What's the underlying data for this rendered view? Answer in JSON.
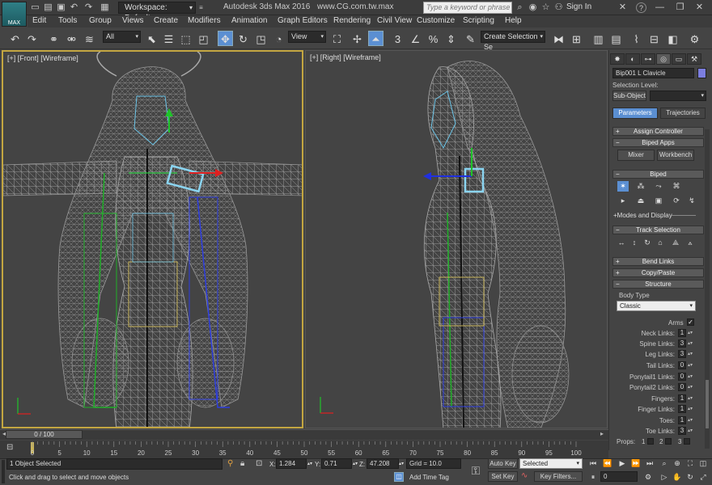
{
  "app": {
    "logo_text": "MAX",
    "workspace_label": "Workspace: Default",
    "title": "Autodesk 3ds Max 2016",
    "url": "www.CG.com.tw.max",
    "search_placeholder": "Type a keyword or phrase",
    "sign_in": "Sign In",
    "help": "?"
  },
  "menu": [
    "Edit",
    "Tools",
    "Group",
    "Views",
    "Create",
    "Modifiers",
    "Animation",
    "Graph Editors",
    "Rendering",
    "Civil View",
    "Customize",
    "Scripting",
    "Help"
  ],
  "toolbar": {
    "selection_filter": "All",
    "reference_coord": "View",
    "named_selection": "Create Selection Se",
    "snap_label": "3",
    "percent_snap_label": "%"
  },
  "viewports": {
    "front_label": "[+] [Front] [Wireframe]",
    "right_label": "[+] [Right] [Wireframe]"
  },
  "command_panel": {
    "object_name": "Bip001 L Clavicle",
    "object_color": "#7c7ee0",
    "selection_level_label": "Selection Level:",
    "sub_object_button": "Sub-Object",
    "tabs": [
      "Parameters",
      "Trajectories"
    ],
    "rollouts": {
      "assign_controller": "Assign Controller",
      "biped_apps": "Biped Apps",
      "mixer": "Mixer",
      "workbench": "Workbench",
      "biped": "Biped",
      "modes_display": "Modes and Display",
      "track_selection": "Track Selection",
      "bend_links": "Bend Links",
      "copy_paste": "Copy/Paste",
      "structure": "Structure"
    },
    "body_type_label": "Body Type",
    "body_type_value": "Classic",
    "arms_label": "Arms",
    "arms_checked": true,
    "links": [
      {
        "label": "Neck Links:",
        "value": "1"
      },
      {
        "label": "Spine Links:",
        "value": "3"
      },
      {
        "label": "Leg Links:",
        "value": "3"
      },
      {
        "label": "Tail Links:",
        "value": "0"
      },
      {
        "label": "Ponytail1 Links:",
        "value": "0"
      },
      {
        "label": "Ponytail2 Links:",
        "value": "0"
      },
      {
        "label": "Fingers:",
        "value": "1"
      },
      {
        "label": "Finger Links:",
        "value": "1"
      },
      {
        "label": "Toes:",
        "value": "1"
      },
      {
        "label": "Toe Links:",
        "value": "3"
      }
    ],
    "props_label": "Props:",
    "props_values": [
      "1",
      "2",
      "3"
    ]
  },
  "timeline": {
    "frame_label": "0 / 100",
    "ticks": [
      "0",
      "5",
      "10",
      "15",
      "20",
      "25",
      "30",
      "35",
      "40",
      "45",
      "50",
      "55",
      "60",
      "65",
      "70",
      "75",
      "80",
      "85",
      "90",
      "95",
      "100"
    ]
  },
  "status": {
    "selection_count": "1 Object Selected",
    "prompt": "Click and drag to select and move objects",
    "x_label": "X:",
    "x_value": "1.284",
    "y_label": "Y:",
    "y_value": "0.71",
    "z_label": "Z:",
    "z_value": "47.208",
    "grid": "Grid = 10.0",
    "add_time_tag": "Add Time Tag",
    "auto_key": "Auto Key",
    "set_key": "Set Key",
    "key_mode": "Selected",
    "key_filters": "Key Filters...",
    "current_frame": "0"
  }
}
